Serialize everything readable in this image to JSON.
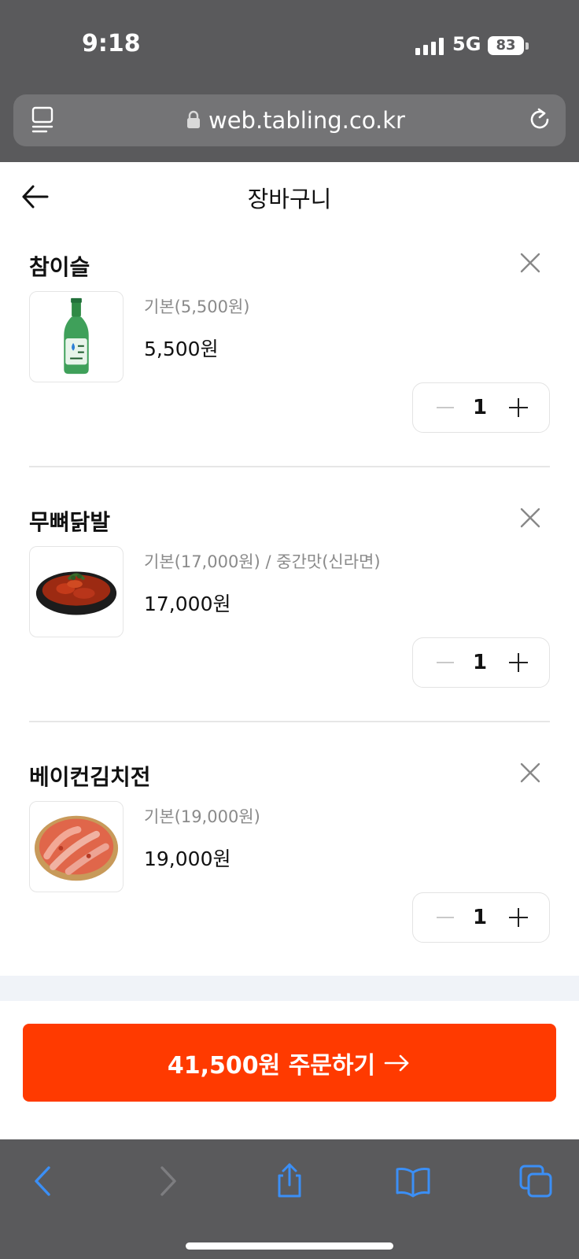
{
  "status_bar": {
    "time": "9:18",
    "network": "5G",
    "battery": "83"
  },
  "browser": {
    "url": "web.tabling.co.kr"
  },
  "header": {
    "title": "장바구니"
  },
  "cart": {
    "items": [
      {
        "name": "참이슬",
        "option": "기본(5,500원)",
        "price": "5,500원",
        "quantity": "1",
        "image": "soju-bottle"
      },
      {
        "name": "무뼈닭발",
        "option": "기본(17,000원) / 중간맛(신라면)",
        "price": "17,000원",
        "quantity": "1",
        "image": "chicken-feet-dish"
      },
      {
        "name": "베이컨김치전",
        "option": "기본(19,000원)",
        "price": "19,000원",
        "quantity": "1",
        "image": "kimchi-pancake"
      }
    ]
  },
  "order_button": {
    "label": "41,500원 주문하기"
  },
  "colors": {
    "accent": "#ff3a00",
    "chrome": "#5a5a5c",
    "safari_blue": "#3b8ff6"
  }
}
